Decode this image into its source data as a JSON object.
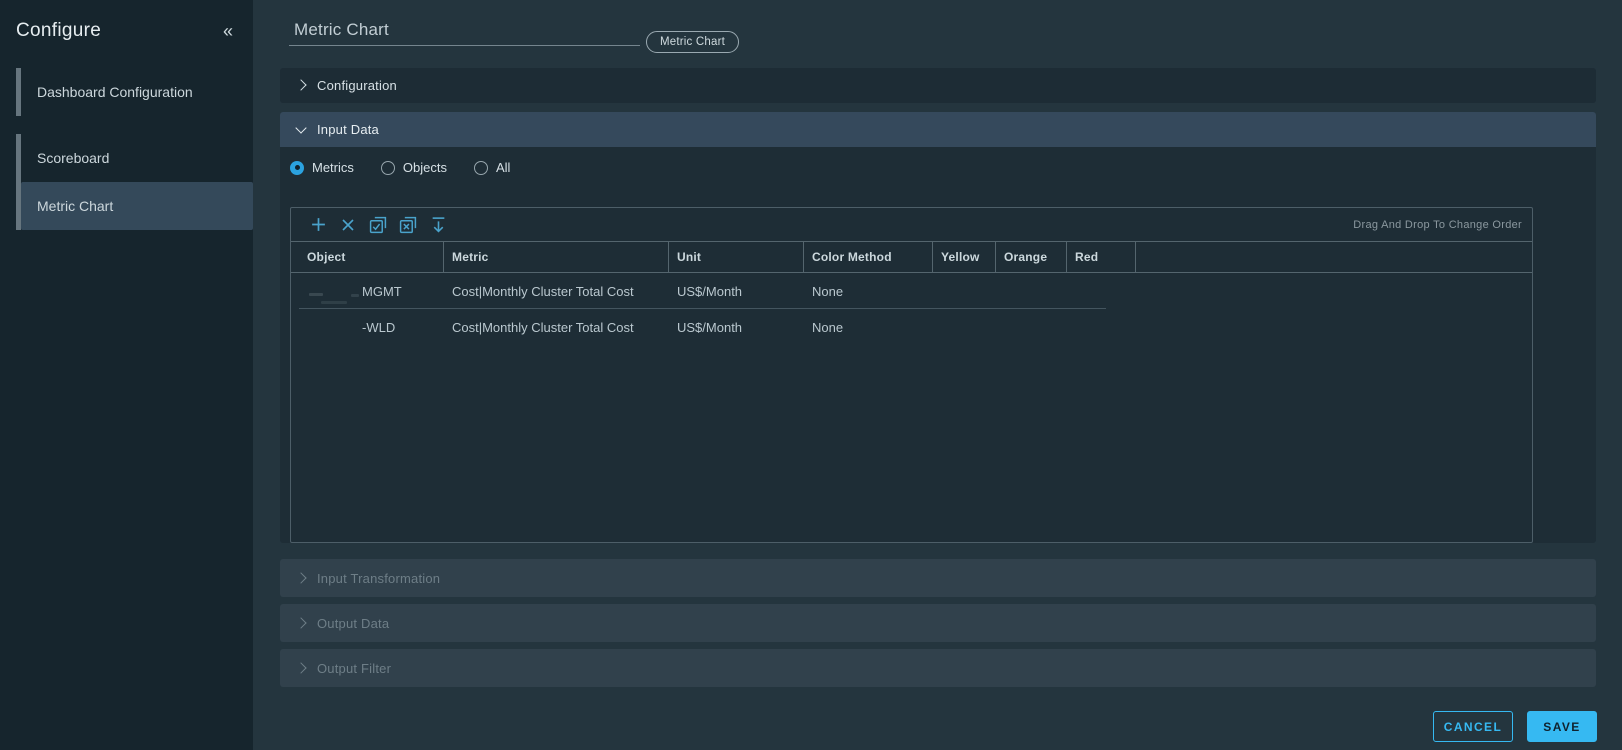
{
  "sidebar": {
    "title": "Configure",
    "collapse_icon": "double-chevron-left",
    "items": [
      {
        "label": "Dashboard Configuration",
        "selected": false
      },
      {
        "label": "Scoreboard",
        "selected": false
      },
      {
        "label": "Metric Chart",
        "selected": true
      }
    ]
  },
  "header": {
    "widget_name_value": "Metric Chart",
    "widget_type_badge": "Metric Chart"
  },
  "sections": {
    "configuration": {
      "label": "Configuration",
      "expanded": false
    },
    "input_data": {
      "label": "Input Data",
      "expanded": true
    },
    "input_transformation": {
      "label": "Input Transformation",
      "disabled": true
    },
    "output_data": {
      "label": "Output Data",
      "disabled": true
    },
    "output_filter": {
      "label": "Output Filter",
      "disabled": true
    }
  },
  "input_data": {
    "radios": [
      {
        "label": "Metrics",
        "selected": true
      },
      {
        "label": "Objects",
        "selected": false
      },
      {
        "label": "All",
        "selected": false
      }
    ],
    "toolbar": {
      "icons": [
        "add-icon",
        "remove-icon",
        "select-all-icon",
        "deselect-all-icon",
        "move-to-bottom-icon"
      ],
      "hint": "Drag And Drop To Change Order"
    },
    "table": {
      "columns": [
        "Object",
        "Metric",
        "Unit",
        "Color Method",
        "Yellow",
        "Orange",
        "Red"
      ],
      "rows": [
        {
          "object": "MGMT",
          "metric": "Cost|Monthly Cluster Total Cost",
          "unit": "US$/Month",
          "color_method": "None",
          "yellow": "",
          "orange": "",
          "red": ""
        },
        {
          "object": "-WLD",
          "metric": "Cost|Monthly Cluster Total Cost",
          "unit": "US$/Month",
          "color_method": "None",
          "yellow": "",
          "orange": "",
          "red": ""
        }
      ]
    }
  },
  "footer": {
    "cancel_label": "CANCEL",
    "save_label": "SAVE"
  },
  "colors": {
    "accent_blue": "#36b9f2",
    "toolbar_icon_blue": "#4aa3cc",
    "radio_selected_blue": "#2ba2e0",
    "sidebar_bg": "#16252d",
    "page_bg": "#24353e",
    "card_bg": "#1e2d36",
    "expanded_header_bg": "#35495c",
    "disabled_bar_bg": "#31414c"
  }
}
